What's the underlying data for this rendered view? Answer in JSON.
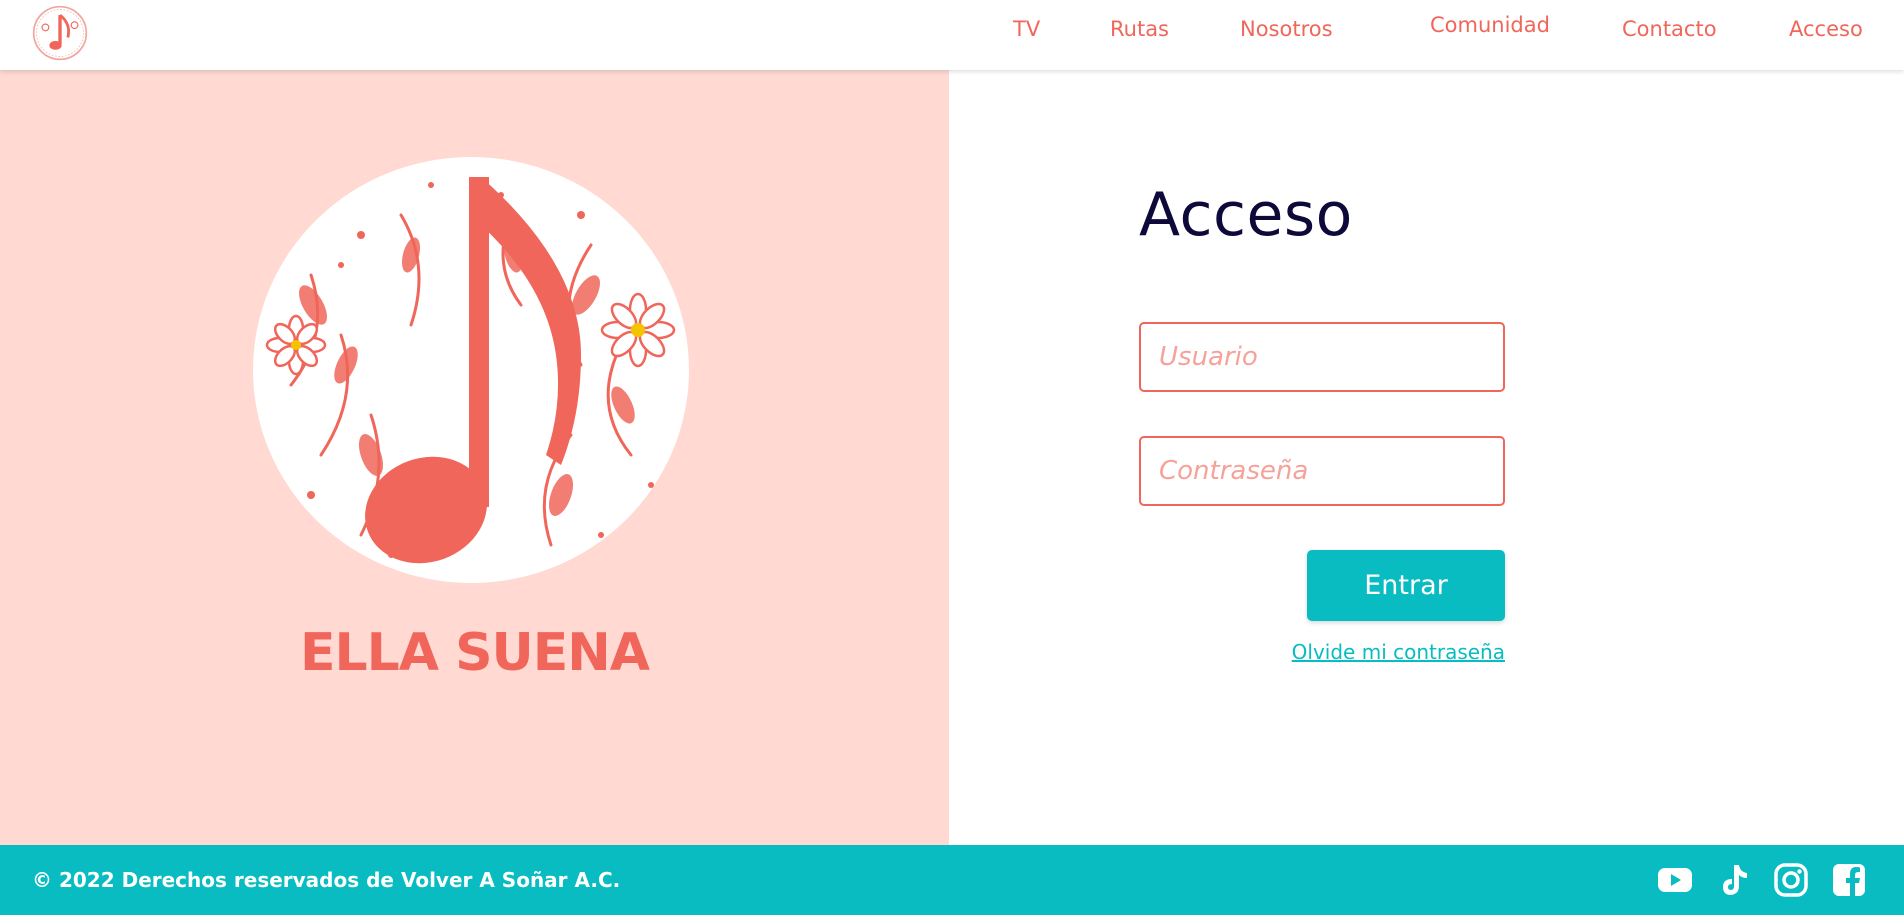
{
  "nav": {
    "logo_icon": "music-note-flower-logo-icon",
    "links": [
      "TV",
      "Rutas",
      "Nosotros",
      "Comunidad",
      "Contacto",
      "Acceso"
    ]
  },
  "brand": {
    "name": "ELLA SUENA",
    "logo_icon": "music-note-floral-circle-logo"
  },
  "login": {
    "title": "Acceso",
    "username_placeholder": "Usuario",
    "username_value": "",
    "password_placeholder": "Contraseña",
    "password_value": "",
    "submit_label": "Entrar",
    "forgot_label": "Olvide mi contraseña"
  },
  "footer": {
    "copyright": "© 2022 Derechos reservados de Volver A Soñar A.C.",
    "social_icons": [
      "youtube-icon",
      "tiktok-icon",
      "instagram-icon",
      "facebook-icon"
    ]
  },
  "colors": {
    "accent_coral": "#f0665a",
    "left_panel_bg": "#ffd9d2",
    "teal": "#08bcc1",
    "title_navy": "#0d0a3a"
  }
}
